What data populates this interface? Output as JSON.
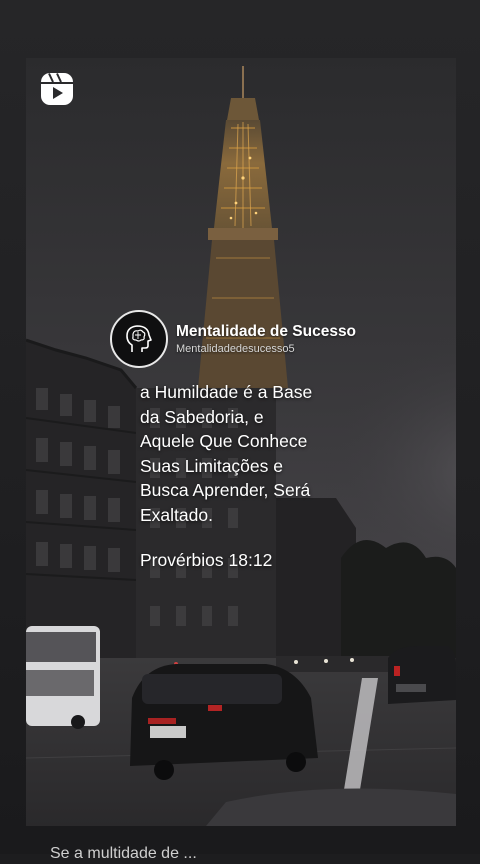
{
  "post": {
    "icon": "reels-icon",
    "profile": {
      "name": "Mentalidade de Sucesso",
      "handle": "Mentalidadedesucesso5",
      "avatar_icon": "brain-head-icon"
    },
    "quote_lines": [
      "a Humildade é a Base",
      "da Sabedoria, e",
      "Aquele Que Conhece",
      "Suas Limitações e",
      "Busca Aprender, Será",
      "Exaltado."
    ],
    "citation": "Provérbios 18:12",
    "background_scene": "eiffel-tower-street-dusk-photo"
  },
  "caption_peek": "Se a multidade de ..."
}
